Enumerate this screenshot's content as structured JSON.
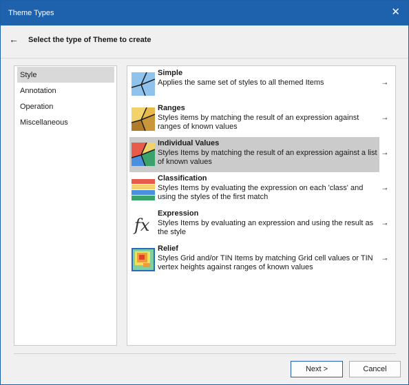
{
  "window": {
    "title": "Theme Types",
    "close_glyph": "✕"
  },
  "header": {
    "back_glyph": "←",
    "title": "Select the type of Theme to create"
  },
  "sidebar": {
    "items": [
      {
        "label": "Style"
      },
      {
        "label": "Annotation"
      },
      {
        "label": "Operation"
      },
      {
        "label": "Miscellaneous"
      }
    ]
  },
  "themes": [
    {
      "name": "Simple",
      "desc": "Applies the same set of styles to all themed Items",
      "icon": "simple-theme-icon"
    },
    {
      "name": "Ranges",
      "desc": "Styles items by matching the result of an expression against ranges of known values",
      "icon": "ranges-theme-icon"
    },
    {
      "name": "Individual Values",
      "desc": "Styles Items by matching the result of an expression against a list of known values",
      "icon": "individual-values-theme-icon"
    },
    {
      "name": "Classification",
      "desc": "Styles Items by evaluating the expression on each 'class' and using the styles of the first match",
      "icon": "classification-theme-icon"
    },
    {
      "name": "Expression",
      "desc": "Styles Items by evaluating an expression and using the result as the style",
      "icon": "expression-theme-icon"
    },
    {
      "name": "Relief",
      "desc": "Styles Grid and/or TIN Items by matching Grid cell values or TIN vertex heights against ranges of known values",
      "icon": "relief-theme-icon"
    }
  ],
  "pin_glyph": "⊸",
  "footer": {
    "next_label": "Next >",
    "cancel_label": "Cancel"
  },
  "colors": {
    "titlebar": "#1e62ad",
    "selection": "#cbcbcb"
  }
}
